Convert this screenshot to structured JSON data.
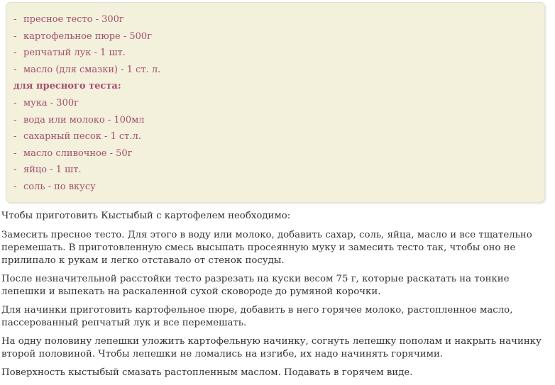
{
  "ingredients": {
    "items": [
      {
        "text": "пресное тесто - 300г"
      },
      {
        "text": "картофельное пюре - 500г"
      },
      {
        "text": "репчатый лук - 1 шт."
      },
      {
        "text": "масло (для смазки) - 1 ст. л."
      }
    ],
    "dough_heading": "для пресного теста:",
    "dough_items": [
      {
        "text": "мука - 300г"
      },
      {
        "text": "вода или молоко - 100мл"
      },
      {
        "text": "сахарный песок - 1 ст.л."
      },
      {
        "text": "масло сливочное - 50г"
      },
      {
        "text": "яйцо - 1 шт."
      },
      {
        "text": "соль - по вкусу"
      }
    ],
    "dash": "-"
  },
  "instructions": {
    "intro": "Чтобы приготовить Кыстыбый с картофелем необходимо:",
    "steps": [
      "Замесить пресное тесто. Для этого в воду или молоко, добавить сахар, соль, яйца, масло и все тщательно перемешать. В приготовленную смесь высыпать просеянную муку и замесить тесто так, чтобы оно не прилипало к рукам и легко отставало от стенок посуды.",
      "После незначительной расстойки тесто разрезать на куски весом 75 г, которые раскатать на тонкие лепешки и выпекать на раскаленной сухой сковороде до румяной корочки.",
      "Для начинки приготовить картофельное пюре, добавить в него горячее молоко, растопленное масло, пассерованный репчатый лук и все перемешать.",
      "На одну половину лепешки уложить картофельную начинку, согнуть лепешку пополам и накрыть начинку второй половиной. Чтобы лепешки не ломались на изгибе, их надо начинять горячими.",
      "Поверхность кыстыбый смазать растопленным маслом. Подавать в горячем виде."
    ]
  }
}
